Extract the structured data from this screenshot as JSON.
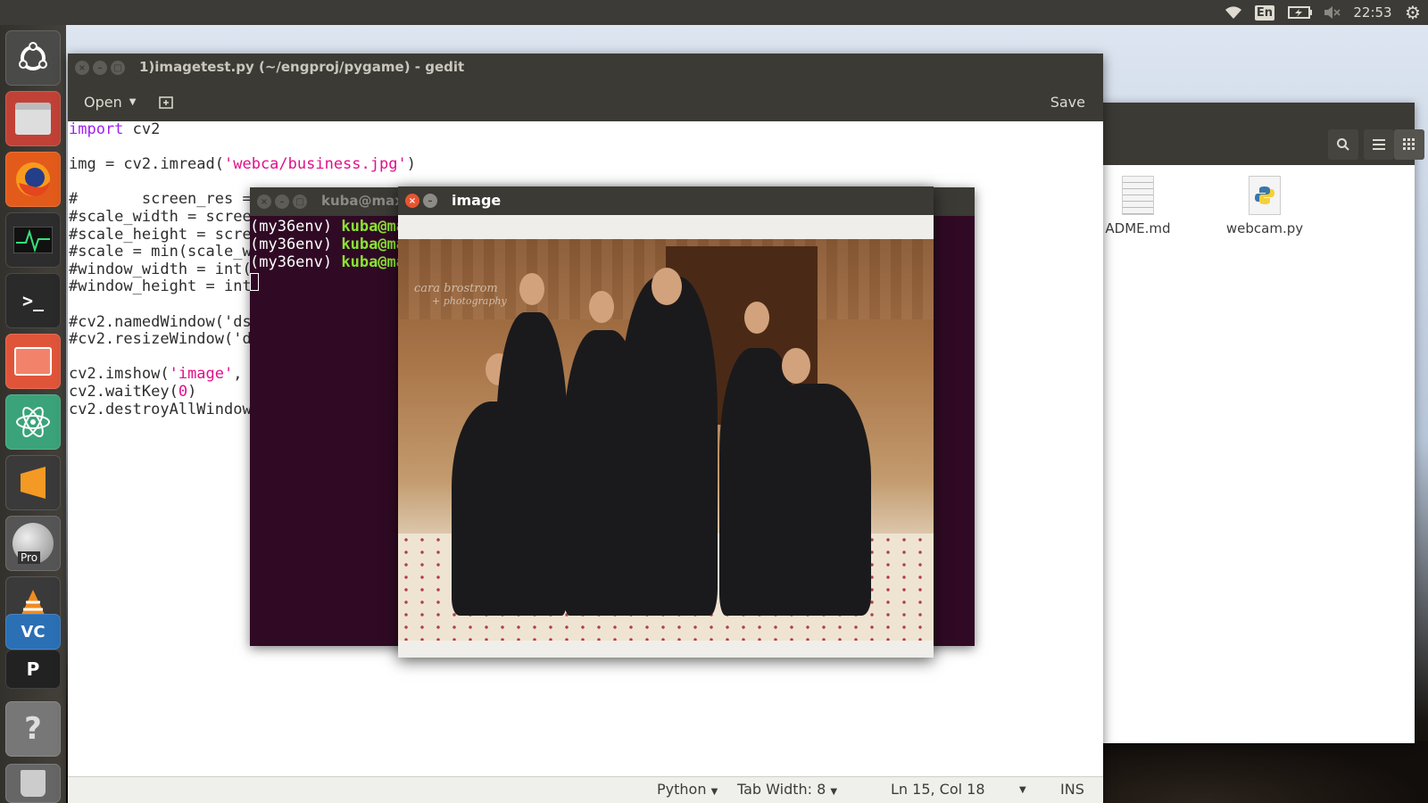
{
  "top_panel": {
    "keyboard_layout": "En",
    "clock": "22:53",
    "icons": [
      "wifi-icon",
      "keyboard-layout-icon",
      "battery-icon",
      "volume-mute-icon",
      "settings-gear-icon"
    ]
  },
  "launcher": {
    "items": [
      "ubuntu-dash",
      "files-cabinet",
      "firefox",
      "system-monitor",
      "terminal",
      "files-folder",
      "atom",
      "sublime-text",
      "google-earth-pro",
      "vlc",
      "vscode",
      "pycharm",
      "help",
      "trash"
    ],
    "google_earth_badge": "Pro"
  },
  "files_window": {
    "items": [
      {
        "name": "ADME.md",
        "icon": "text-file-icon"
      },
      {
        "name": "webcam.py",
        "icon": "python-file-icon"
      }
    ]
  },
  "gedit": {
    "title": "1)imagetest.py (~/engproj/pygame) - gedit",
    "open_label": "Open",
    "save_label": "Save",
    "code": {
      "l1_kw": "import",
      "l1_rest": " cv2",
      "l3_a": "img = cv2.imread(",
      "l3_str": "'webca/business.jpg'",
      "l3_b": ")",
      "l5": "#       screen_res =",
      "l6": "#scale_width = scree",
      "l7": "#scale_height = scre",
      "l8": "#scale = min(scale_w",
      "l9": "#window_width = int(",
      "l10": "#window_height = int",
      "l12": "#cv2.namedWindow('ds",
      "l13": "#cv2.resizeWindow('d",
      "l15_a": "cv2.imshow(",
      "l15_str": "'image'",
      "l15_b": ", i",
      "l16_a": "cv2.waitKey(",
      "l16_num": "0",
      "l16_b": ")",
      "l17": "cv2.destroyAllWindow"
    },
    "status": {
      "language": "Python",
      "tab_width": "Tab Width: 8",
      "position": "Ln 15, Col 18",
      "mode": "INS"
    }
  },
  "terminal": {
    "title": "kuba@max",
    "prompt_env": "(my36env) ",
    "prompt_user": "kuba@ma"
  },
  "image_window": {
    "title": "image",
    "watermark_line1": "cara brostrom",
    "watermark_line2": "+ photography"
  },
  "colors": {
    "panel": "#3c3b37",
    "window_chrome": "#3b3a35",
    "terminal_bg": "#300a24",
    "prompt_green": "#8ae234",
    "close_button": "#e9542f",
    "keyword": "#a020f0",
    "string": "#e0108a"
  }
}
